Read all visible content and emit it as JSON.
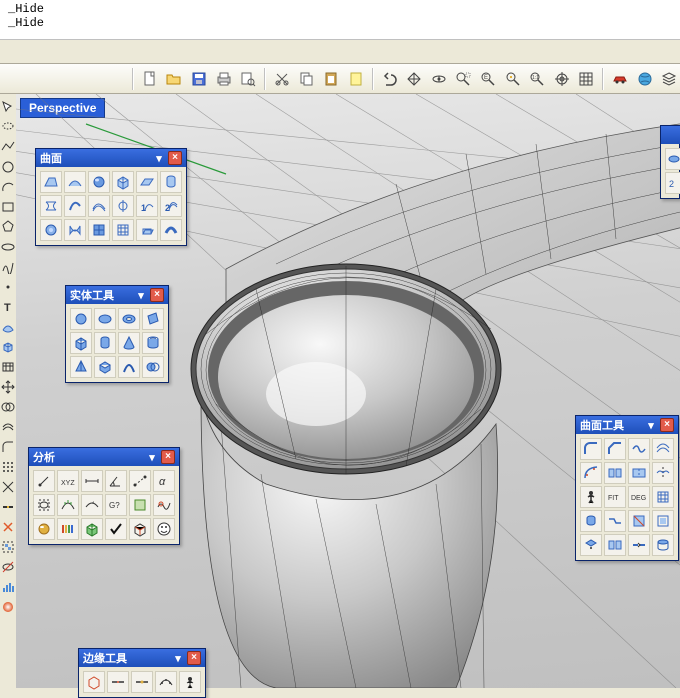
{
  "command_history": {
    "line1": "_Hide",
    "line2": "_Hide"
  },
  "viewport": {
    "label": "Perspective"
  },
  "main_toolbar": {
    "icons": [
      "new-file",
      "open-file",
      "save-file",
      "print",
      "print-preview",
      "cut",
      "copy",
      "paste",
      "note",
      "undo",
      "pan",
      "rotate-view",
      "zoom-window",
      "zoom-extents",
      "zoom-selected",
      "zoom-1to1",
      "zoom-target",
      "grid",
      "render-car",
      "render-globe",
      "layer"
    ]
  },
  "left_toolbar": {
    "icons": [
      "pointer",
      "lasso",
      "rectangle",
      "polyline",
      "circle",
      "arc",
      "ellipse",
      "polygon",
      "curve",
      "text",
      "dimension",
      "point",
      "surface",
      "solid",
      "mesh",
      "transform",
      "boolean",
      "offset",
      "fillet",
      "array",
      "trim",
      "split",
      "join",
      "explode",
      "group",
      "hide",
      "lock",
      "analyze",
      "render",
      "measure"
    ]
  },
  "toolboxes": {
    "surface": {
      "title": "曲面",
      "rows": 3,
      "cols": 6,
      "icons": [
        "srf-corner",
        "srf-edge",
        "sphere",
        "box",
        "cyl",
        "cone",
        "loft",
        "sweep1",
        "sweep2",
        "revolve",
        "rail1",
        "rail2",
        "patch",
        "drape",
        "plane",
        "heightfield",
        "network",
        "extrude"
      ]
    },
    "solid_tools": {
      "title": "实体工具",
      "rows": 3,
      "cols": 4,
      "icons": [
        "sphere-solid",
        "ellipsoid",
        "torus",
        "pipe",
        "box-solid",
        "cyl-solid",
        "cone-solid",
        "tube",
        "pyramid",
        "extrude-solid",
        "text-solid",
        "boolean-solid"
      ]
    },
    "analyze": {
      "title": "分析",
      "rows": 3,
      "cols": 6,
      "icons": [
        "point-eval",
        "xyz-coord",
        "length",
        "line-angle",
        "distance",
        "angle",
        "radius",
        "curvature",
        "direction",
        "draft",
        "area",
        "curvature-graph",
        "emap",
        "zebra",
        "gaussian",
        "check",
        "edge-analysis",
        "what"
      ]
    },
    "edge_tools": {
      "title": "边缘工具",
      "rows": 1,
      "cols": 5,
      "icons": [
        "show-edges",
        "split-edge",
        "merge-edge",
        "rebuild-edge",
        "edge-continuity"
      ]
    },
    "surface_tools": {
      "title": "曲面工具",
      "rows": 5,
      "cols": 4,
      "icons": [
        "fillet-srf",
        "chamfer-srf",
        "blend-srf",
        "offset-srf",
        "variable-fillet",
        "match-srf",
        "merge-srf",
        "symmetry",
        "unroll",
        "fit",
        "deg",
        "rebuild",
        "extend-srf",
        "connect-srf",
        "trim-srf",
        "untrim",
        "shrink",
        "split-srf",
        "join-srf",
        "cap"
      ]
    },
    "partial": {
      "title": "",
      "icons": [
        "box-p",
        "cyl-p"
      ]
    }
  }
}
